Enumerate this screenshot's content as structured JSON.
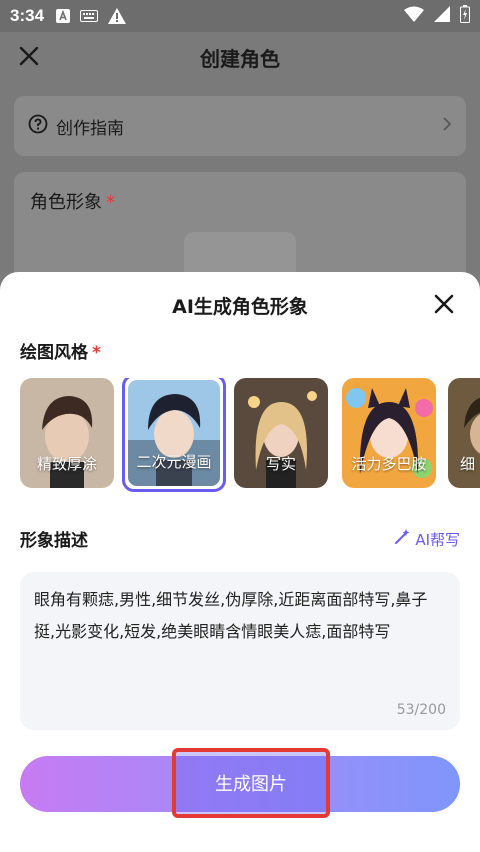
{
  "status_bar": {
    "time": "3:34"
  },
  "page": {
    "title": "创建角色",
    "guide_label": "创作指南",
    "role_label": "角色形象",
    "required_mark": "*"
  },
  "sheet": {
    "title": "AI生成角色形象",
    "style_label": "绘图风格",
    "required_mark": "*",
    "styles": [
      {
        "label": "精致厚涂",
        "selected": false
      },
      {
        "label": "二次元漫画",
        "selected": true
      },
      {
        "label": "写实",
        "selected": false
      },
      {
        "label": "活力多巴胺",
        "selected": false
      },
      {
        "label": "细",
        "selected": false
      }
    ],
    "desc_label": "形象描述",
    "ai_help_label": "AI帮写",
    "description": "眼角有颗痣,男性,细节发丝,伪厚除,近距离面部特写,鼻子挺,光影变化,短发,绝美眼睛含情眼美人痣,面部特写",
    "char_count": "53/200",
    "generate_label": "生成图片"
  },
  "colors": {
    "accent": "#6a5cf0",
    "required": "#e53935",
    "highlight_box": "#e53935"
  }
}
